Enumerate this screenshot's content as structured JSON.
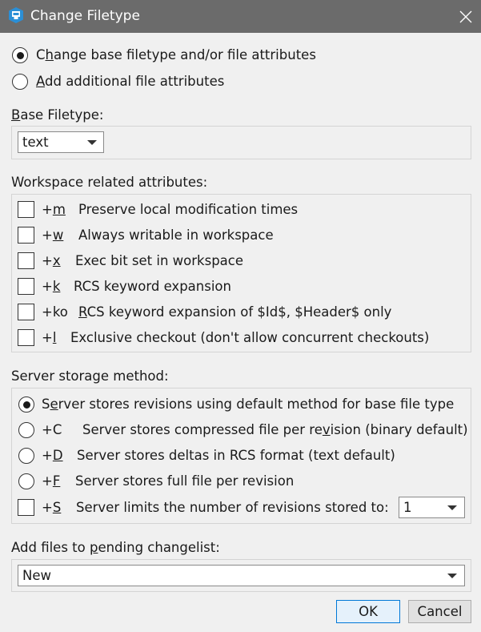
{
  "window": {
    "title": "Change Filetype"
  },
  "mode": {
    "options": [
      {
        "mnemonic": "h",
        "before": "C",
        "after": "ange base filetype and/or file attributes",
        "checked": true
      },
      {
        "mnemonic": "A",
        "before": "",
        "after": "dd additional file attributes",
        "checked": false
      }
    ]
  },
  "base_filetype": {
    "label_mnemonic": "B",
    "label_rest": "ase Filetype:",
    "value": "text"
  },
  "workspace": {
    "label": "Workspace related attributes:",
    "items": [
      {
        "code_prefix": "+",
        "code_mn": "m",
        "code_rest": "",
        "desc": "Preserve local modification times"
      },
      {
        "code_prefix": "+",
        "code_mn": "w",
        "code_rest": "",
        "desc": "Always writable in workspace"
      },
      {
        "code_prefix": "+",
        "code_mn": "x",
        "code_rest": "",
        "desc": "Exec bit set in workspace"
      },
      {
        "code_prefix": "+",
        "code_mn": "k",
        "code_rest": "",
        "desc": "RCS keyword expansion"
      },
      {
        "code_prefix": "+ko",
        "code_mn": "",
        "code_rest": "",
        "desc_mn": "R",
        "desc": "CS keyword expansion of $Id$, $Header$ only"
      },
      {
        "code_prefix": "+",
        "code_mn": "l",
        "code_rest": "",
        "desc": "Exclusive checkout (don't allow concurrent checkouts)"
      }
    ]
  },
  "storage": {
    "label": "Server storage method:",
    "options": [
      {
        "code": "",
        "desc_before": "S",
        "desc_mn": "e",
        "desc_after": "rver stores revisions using default method for base file type",
        "checked": true
      },
      {
        "code": "+C",
        "desc_before": "Server stores compressed file per re",
        "desc_mn": "v",
        "desc_after": "ision (binary default)",
        "checked": false
      },
      {
        "code_prefix": "+",
        "code_mn": "D",
        "desc_before": "Server stores deltas in RCS format (text default)",
        "desc_mn": "",
        "desc_after": "",
        "checked": false
      },
      {
        "code_prefix": "+",
        "code_mn": "F",
        "desc_before": "Server stores full file per revision",
        "desc_mn": "",
        "desc_after": "",
        "checked": false
      }
    ],
    "limit": {
      "code_prefix": "+",
      "code_mn": "S",
      "desc": "Server limits the number of revisions stored to:",
      "value": "1",
      "checked": false
    }
  },
  "changelist": {
    "label_before": "Add files to ",
    "label_mn": "p",
    "label_after": "ending changelist:",
    "value": "New"
  },
  "buttons": {
    "ok": "OK",
    "cancel": "Cancel"
  }
}
